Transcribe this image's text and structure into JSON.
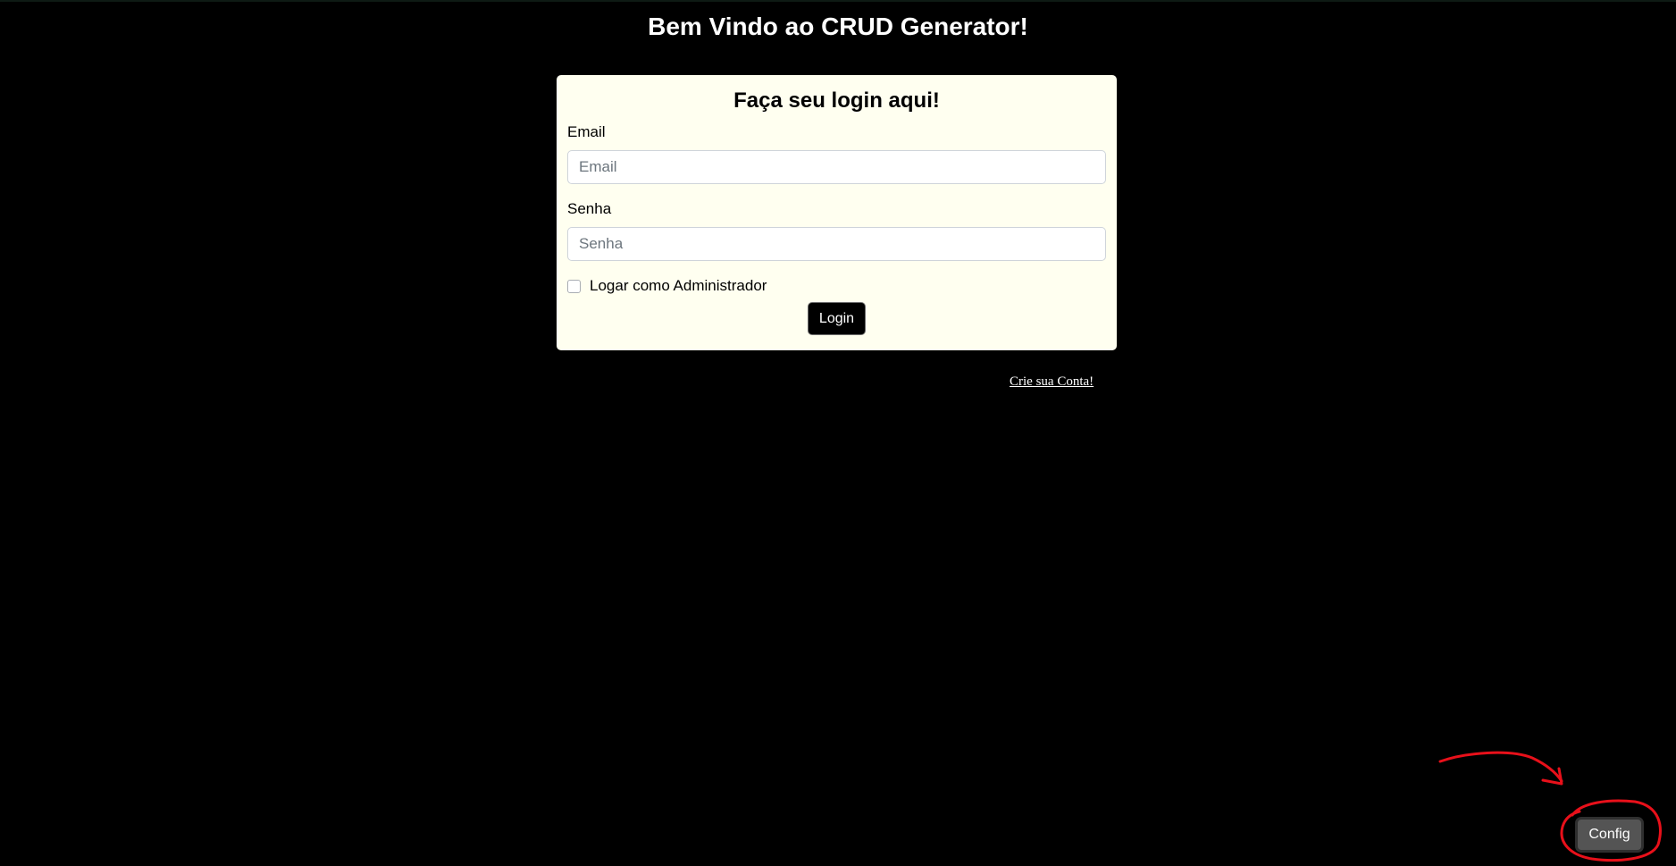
{
  "header": {
    "title": "Bem Vindo ao CRUD Generator!"
  },
  "login_form": {
    "title": "Faça seu login aqui!",
    "email_label": "Email",
    "email_placeholder": "Email",
    "email_value": "",
    "password_label": "Senha",
    "password_placeholder": "Senha",
    "password_value": "",
    "admin_checkbox_label": "Logar como Administrador",
    "admin_checked": false,
    "login_button_label": "Login"
  },
  "create_account_link": "Crie sua Conta!",
  "config_button_label": "Config",
  "annotation": {
    "color": "#e8101a",
    "icon": "hand-drawn-arrow-and-circle"
  },
  "colors": {
    "background": "#000000",
    "card": "#fffff0",
    "config_button": "#545454"
  }
}
